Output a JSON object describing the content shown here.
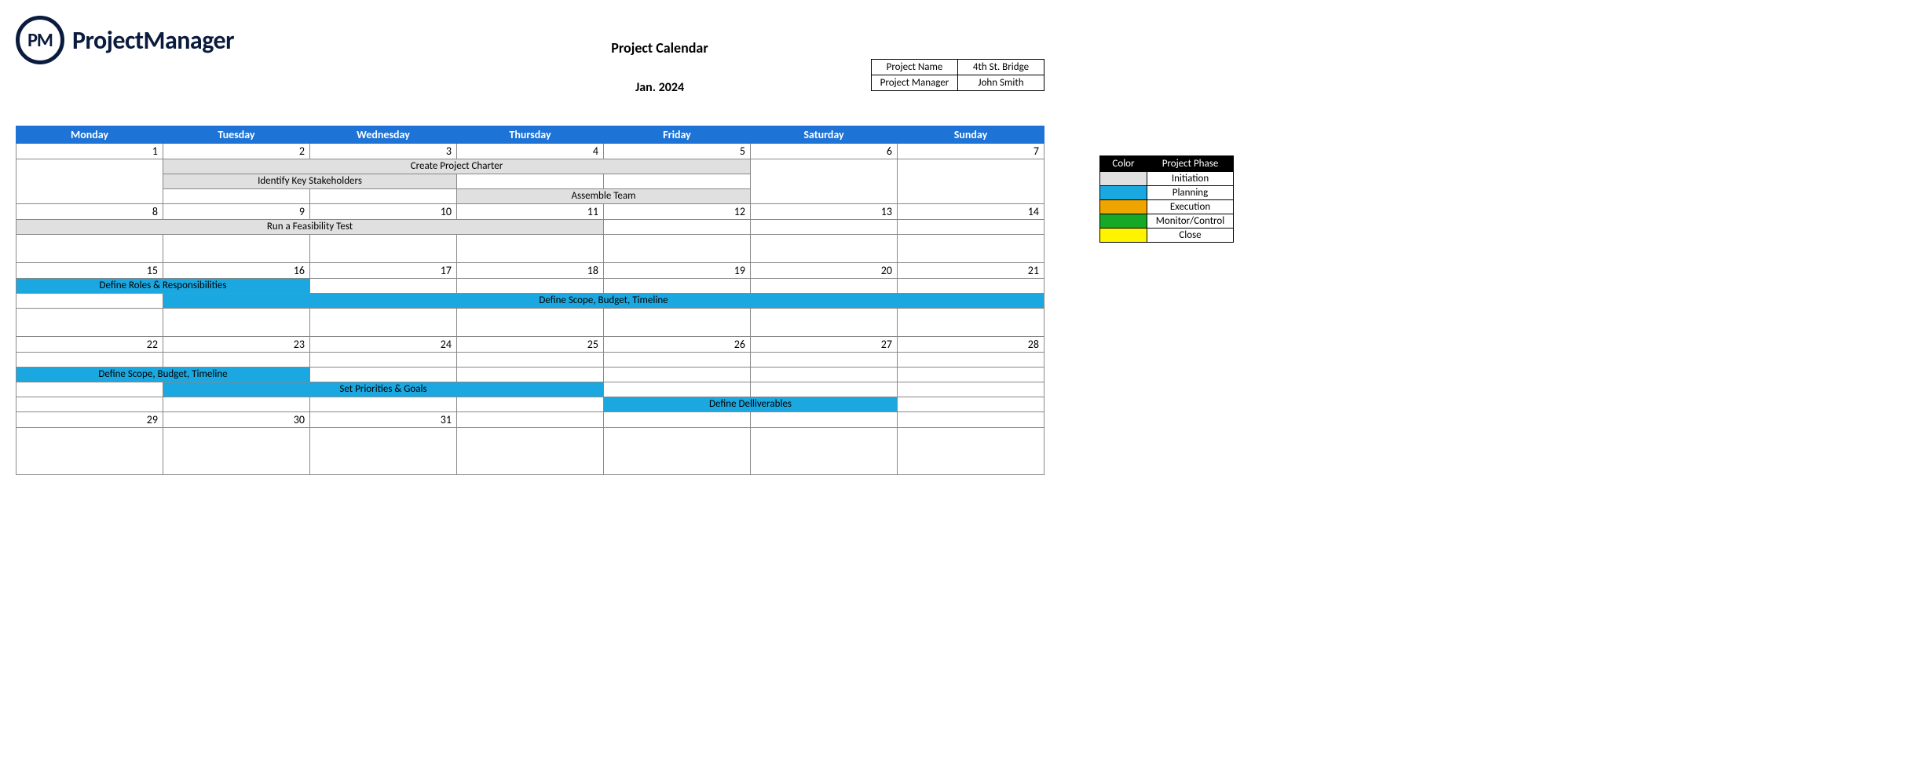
{
  "logo": {
    "mark": "PM",
    "text": "ProjectManager"
  },
  "title": "Project Calendar",
  "subtitle": "Jan. 2024",
  "meta": {
    "project_name_label": "Project Name",
    "project_name_value": "4th St. Bridge",
    "project_manager_label": "Project Manager",
    "project_manager_value": "John Smith"
  },
  "days": [
    "Monday",
    "Tuesday",
    "Wednesday",
    "Thursday",
    "Friday",
    "Saturday",
    "Sunday"
  ],
  "weeks": [
    {
      "nums": [
        "1",
        "2",
        "3",
        "4",
        "5",
        "6",
        "7"
      ]
    },
    {
      "nums": [
        "8",
        "9",
        "10",
        "11",
        "12",
        "13",
        "14"
      ]
    },
    {
      "nums": [
        "15",
        "16",
        "17",
        "18",
        "19",
        "20",
        "21"
      ]
    },
    {
      "nums": [
        "22",
        "23",
        "24",
        "25",
        "26",
        "27",
        "28"
      ]
    },
    {
      "nums": [
        "29",
        "30",
        "31",
        "",
        "",
        "",
        ""
      ]
    }
  ],
  "tasks": {
    "charter": "Create Project Charter",
    "stakeholders": "Identify Key Stakeholders",
    "assemble": "Assemble Team",
    "feasibility": "Run a Feasibility Test",
    "roles": "Define Roles & Responsibilities",
    "scope": "Define Scope, Budget, Timeline",
    "scope2": "Define Scope, Budget, Timeline",
    "priorities": "Set Priorities & Goals",
    "deliverables": "Define Delliverables"
  },
  "legend": {
    "color_header": "Color",
    "phase_header": "Project Phase",
    "rows": [
      {
        "class": "initiation",
        "label": "Initiation"
      },
      {
        "class": "planning",
        "label": "Planning"
      },
      {
        "class": "execution",
        "label": "Execution"
      },
      {
        "class": "monitor",
        "label": "Monitor/Control"
      },
      {
        "class": "close",
        "label": "Close"
      }
    ]
  }
}
